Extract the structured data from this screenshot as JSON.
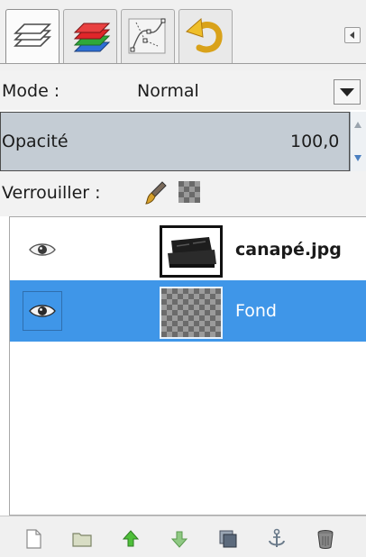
{
  "tabs": [
    {
      "name": "layers",
      "icon": "layers-icon",
      "active": true
    },
    {
      "name": "channels",
      "icon": "channels-icon",
      "active": false
    },
    {
      "name": "paths",
      "icon": "paths-icon",
      "active": false
    },
    {
      "name": "undo-history",
      "icon": "undo-icon",
      "active": false
    }
  ],
  "mode": {
    "label": "Mode :",
    "value": "Normal"
  },
  "opacity": {
    "label": "Opacité",
    "value": "100,0"
  },
  "lock": {
    "label": "Verrouiller :"
  },
  "layers": [
    {
      "name": "canapé.jpg",
      "visible": true,
      "selected": false
    },
    {
      "name": "Fond",
      "visible": true,
      "selected": true
    }
  ],
  "toolbar": [
    "new-layer-icon",
    "new-layer-group-icon",
    "raise-layer-icon",
    "lower-layer-icon",
    "duplicate-layer-icon",
    "anchor-layer-icon",
    "delete-layer-icon"
  ],
  "colors": {
    "selection": "#3f96e8",
    "opacity_bg": "#c4ccd4"
  }
}
